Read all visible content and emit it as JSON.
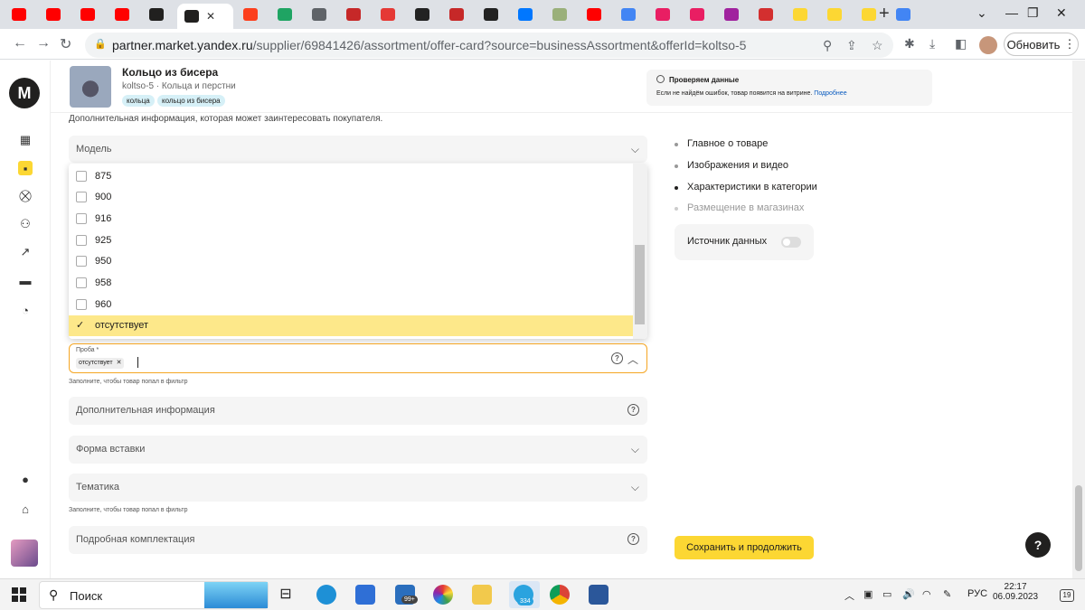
{
  "browser": {
    "active_tab_title": "",
    "url_host": "partner.market.yandex.ru",
    "url_path": "/supplier/69841426/assortment/offer-card?source=businessAssortment&offerId=koltso-5",
    "update_label": "Обновить",
    "tabs": [
      {
        "icon": "youtube-icon",
        "color": "#ff0000"
      },
      {
        "icon": "youtube-icon",
        "color": "#ff0000"
      },
      {
        "icon": "youtube-icon",
        "color": "#ff0000"
      },
      {
        "icon": "youtube-icon",
        "color": "#ff0000"
      },
      {
        "icon": "yandex-market-icon",
        "color": "#21201f"
      },
      {
        "icon": "yandex-market-icon",
        "color": "#21201f"
      },
      {
        "icon": "yandex-icon",
        "color": "#fc3f1d"
      },
      {
        "icon": "google-drive-icon",
        "color": "#1fa463"
      },
      {
        "icon": "book-icon",
        "color": "#5f6368"
      },
      {
        "icon": "app-icon",
        "color": "#c62828"
      },
      {
        "icon": "chart-icon",
        "color": "#e53935"
      },
      {
        "icon": "plus-circle-icon",
        "color": "#222222"
      },
      {
        "icon": "app-icon",
        "color": "#c62828"
      },
      {
        "icon": "notion-icon",
        "color": "#222222"
      },
      {
        "icon": "vk-icon",
        "color": "#0077ff"
      },
      {
        "icon": "circle-icon",
        "color": "#9ab07a"
      },
      {
        "icon": "youtube-icon",
        "color": "#ff0000"
      },
      {
        "icon": "google-icon",
        "color": "#4285f4"
      },
      {
        "icon": "app-icon",
        "color": "#e91e63"
      },
      {
        "icon": "app-icon",
        "color": "#e91e63"
      },
      {
        "icon": "wildberries-icon",
        "color": "#a0229e"
      },
      {
        "icon": "app-icon",
        "color": "#d32f2f"
      },
      {
        "icon": "yandex-market-icon",
        "color": "#fcd733"
      },
      {
        "icon": "yandex-market-icon",
        "color": "#fcd733"
      },
      {
        "icon": "yandex-market-icon",
        "color": "#fcd733"
      },
      {
        "icon": "google-icon",
        "color": "#4285f4"
      }
    ]
  },
  "product": {
    "title": "Кольцо из бисера",
    "subtitle": "koltso-5 · Кольца и перстни",
    "chips": [
      "кольца",
      "кольцо из бисера"
    ]
  },
  "notice": {
    "title": "Проверяем данные",
    "body": "Если не найдём ошибок, товар появится на витрине.",
    "link": "Подробнее"
  },
  "form": {
    "info_text": "Дополнительная информация, которая может заинтересовать покупателя.",
    "model_label": "Модель",
    "options": [
      {
        "label": "875",
        "checked": false
      },
      {
        "label": "900",
        "checked": false
      },
      {
        "label": "916",
        "checked": false
      },
      {
        "label": "925",
        "checked": false
      },
      {
        "label": "950",
        "checked": false
      },
      {
        "label": "958",
        "checked": false
      },
      {
        "label": "960",
        "checked": false
      },
      {
        "label": "отсутствует",
        "checked": true
      }
    ],
    "proba_label": "Проба *",
    "proba_value": "отсутствует",
    "filter_hint": "Заполните, чтобы товар попал в фильтр",
    "additional_info_label": "Дополнительная информация",
    "insert_form_label": "Форма вставки",
    "theme_label": "Тематика",
    "theme_hint": "Заполните, чтобы товар попал в фильтр",
    "kit_label": "Подробная комплектация"
  },
  "nav": {
    "items": [
      "Главное о товаре",
      "Изображения и видео",
      "Характеристики в категории",
      "Размещение в магазинах"
    ],
    "data_source_label": "Источник данных",
    "data_source_enabled": false,
    "save_label": "Сохранить и продолжить",
    "help_label": "?"
  },
  "taskbar": {
    "search_label": "Поиск",
    "mail_badge": "99+",
    "telegram_badge": "334",
    "lang": "РУС",
    "time": "22:17",
    "date": "06.09.2023",
    "notifications": "19"
  }
}
